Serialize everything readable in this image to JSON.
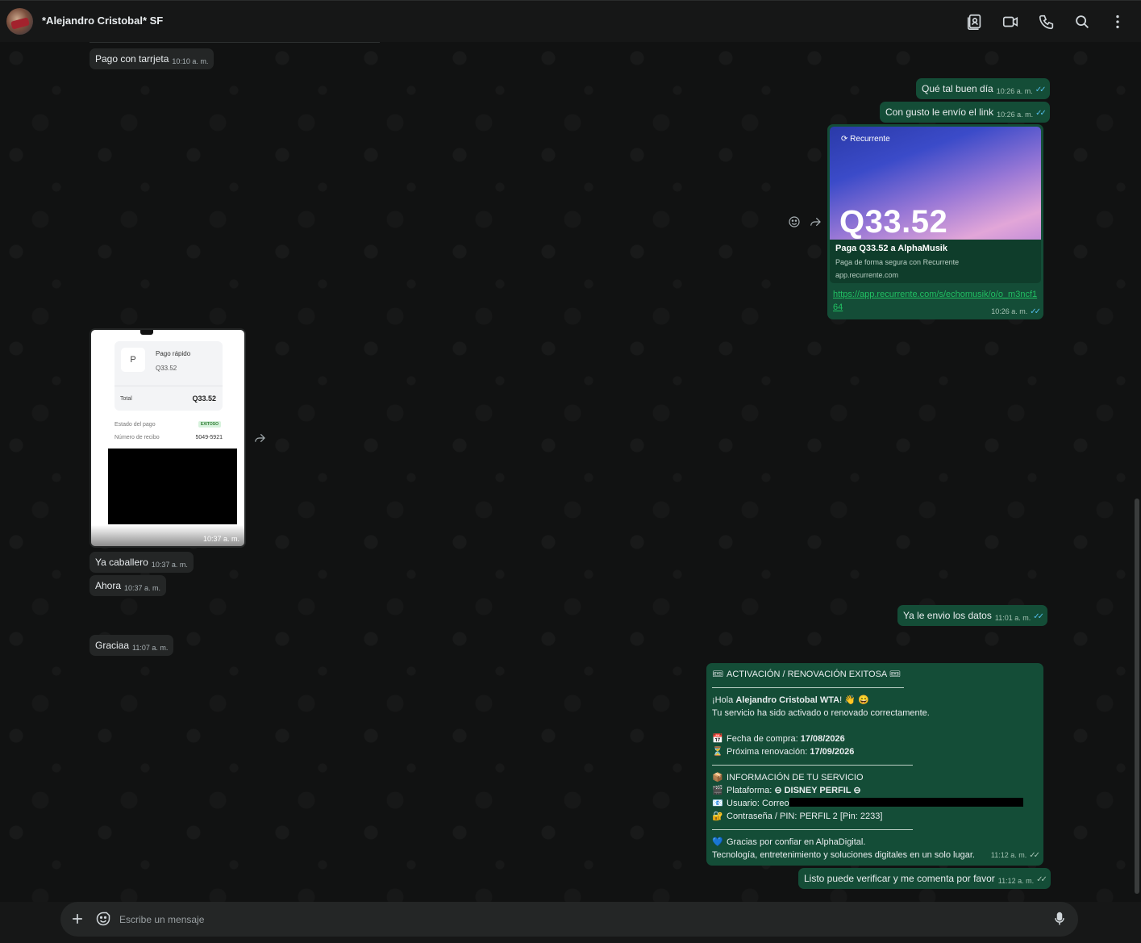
{
  "header": {
    "title": "*Alejandro Cristobal* SF",
    "icons": [
      "contact-card-icon",
      "video-call-icon",
      "voice-call-icon",
      "search-icon",
      "more-options-icon"
    ]
  },
  "messages": {
    "m1": {
      "text": "Pago con tarrjeta",
      "time": "10:10 a. m."
    },
    "m2": {
      "text": "Qué tal buen día",
      "time": "10:26 a. m."
    },
    "m3": {
      "text": "Con gusto le envío el link",
      "time": "10:26 a. m."
    },
    "link": {
      "brand": "Recurrente",
      "amount": "Q33.52",
      "title": "Paga Q33.52 a AlphaMusik",
      "description": "Paga de forma segura con Recurrente",
      "domain": "app.recurrente.com",
      "url": "https://app.recurrente.com/s/echomusik/o/o_m3ncf164",
      "time": "10:26 a. m."
    },
    "receipt": {
      "merchant_initial": "P",
      "merchant": "Pago rápido",
      "amount": "Q33.52",
      "total_label": "Total",
      "total_value": "Q33.52",
      "status_label": "Estado del pago",
      "status_value": "EXITOSO",
      "receipt_label": "Número de recibo",
      "receipt_value": "5049-5921",
      "time": "10:37 a. m."
    },
    "m4": {
      "text": "Ya caballero",
      "time": "10:37 a. m."
    },
    "m5": {
      "text": "Ahora",
      "time": "10:37 a. m."
    },
    "m6": {
      "text": "Ya le envio los datos",
      "time": "11:01 a. m."
    },
    "m7": {
      "text": "Graciaa",
      "time": "11:07 a. m."
    },
    "activation": {
      "heading": "ACTIVACIÓN / RENOVACIÓN EXITOSA",
      "greeting_prefix": "¡Hola ",
      "greeting_name": "Alejandro Cristobal WTA",
      "greeting_suffix": "! 👋 😄",
      "line_activated": "Tu servicio ha sido activado o renovado correctamente.",
      "purchase_label": "Fecha de compra: ",
      "purchase_date": "17/08/2026",
      "renewal_label": "Próxima renovación: ",
      "renewal_date": "17/09/2026",
      "info_heading": "INFORMACIÓN DE TU SERVICIO",
      "platform_label": "Plataforma: ",
      "platform_value": "⊖ DISNEY PERFIL ⊖",
      "user_label": "Usuario: Correo",
      "password_label": "Contraseña / PIN: PERFIL 2 [Pin: 2233]",
      "thanks": "Gracias por confiar en AlphaDigital.",
      "tagline": "Tecnología, entretenimiento y soluciones digitales en un solo lugar.",
      "time": "11:12 a. m."
    },
    "m8": {
      "text": "Listo puede verificar y me comenta por favor",
      "time": "11:12 a. m."
    }
  },
  "composer": {
    "placeholder": "Escribe un mensaje"
  },
  "colors": {
    "incoming_bubble": "#242626",
    "outgoing_bubble": "#144d37",
    "read_ticks": "#53bdeb",
    "link": "#21c063"
  }
}
